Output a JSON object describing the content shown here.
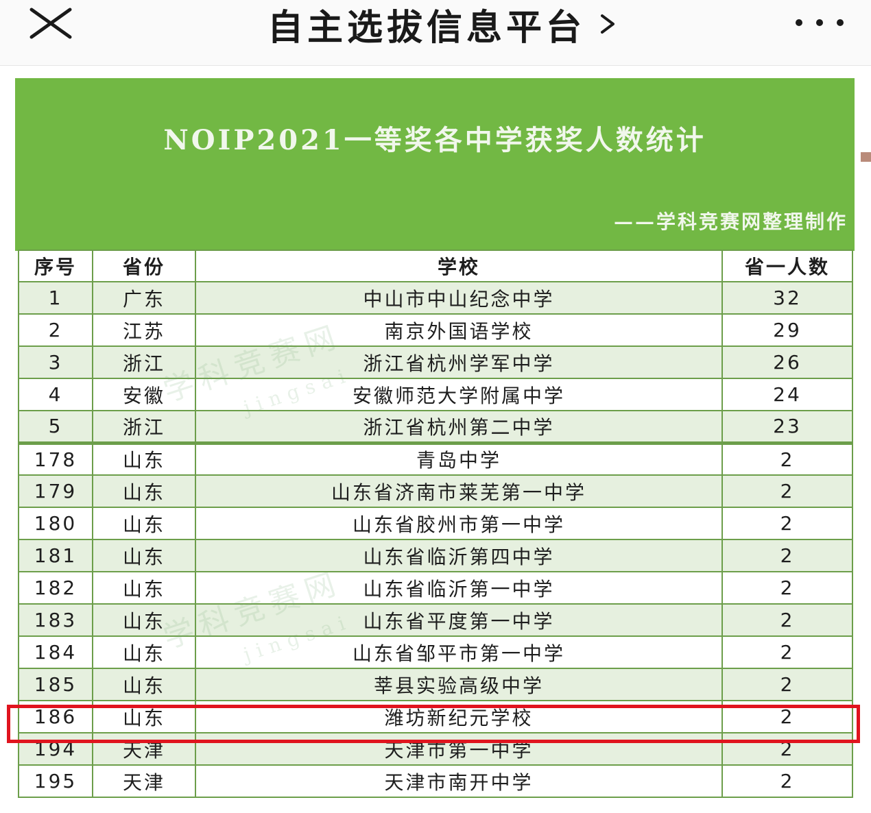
{
  "header": {
    "title": "自主选拔信息平台",
    "close_icon": "close-icon",
    "chevron_icon": "chevron-right-icon",
    "more_icon": "more-dots-icon"
  },
  "banner": {
    "title": "NOIP2021一等奖各中学获奖人数统计",
    "subtitle": "——学科竞赛网整理制作",
    "color": "#72b844"
  },
  "watermark": {
    "text": "学科竞赛网",
    "subtext": "jingsai"
  },
  "table": {
    "headers": [
      "序号",
      "省份",
      "学校",
      "省一人数"
    ],
    "rows": [
      {
        "rank": "1",
        "province": "广东",
        "school": "中山市中山纪念中学",
        "count": "32"
      },
      {
        "rank": "2",
        "province": "江苏",
        "school": "南京外国语学校",
        "count": "29"
      },
      {
        "rank": "3",
        "province": "浙江",
        "school": "浙江省杭州学军中学",
        "count": "26"
      },
      {
        "rank": "4",
        "province": "安徽",
        "school": "安徽师范大学附属中学",
        "count": "24"
      },
      {
        "rank": "5",
        "province": "浙江",
        "school": "浙江省杭州第二中学",
        "count": "23"
      },
      {
        "rank": "178",
        "province": "山东",
        "school": "青岛中学",
        "count": "2"
      },
      {
        "rank": "179",
        "province": "山东",
        "school": "山东省济南市莱芜第一中学",
        "count": "2"
      },
      {
        "rank": "180",
        "province": "山东",
        "school": "山东省胶州市第一中学",
        "count": "2"
      },
      {
        "rank": "181",
        "province": "山东",
        "school": "山东省临沂第四中学",
        "count": "2"
      },
      {
        "rank": "182",
        "province": "山东",
        "school": "山东省临沂第一中学",
        "count": "2"
      },
      {
        "rank": "183",
        "province": "山东",
        "school": "山东省平度第一中学",
        "count": "2"
      },
      {
        "rank": "184",
        "province": "山东",
        "school": "山东省邹平市第一中学",
        "count": "2"
      },
      {
        "rank": "185",
        "province": "山东",
        "school": "莘县实验高级中学",
        "count": "2"
      },
      {
        "rank": "186",
        "province": "山东",
        "school": "潍坊新纪元学校",
        "count": "2"
      },
      {
        "rank": "194",
        "province": "天津",
        "school": "天津市第一中学",
        "count": "2"
      },
      {
        "rank": "195",
        "province": "天津",
        "school": "天津市南开中学",
        "count": "2"
      }
    ],
    "highlight_rank": "186",
    "highlight_color": "#e0141e"
  }
}
